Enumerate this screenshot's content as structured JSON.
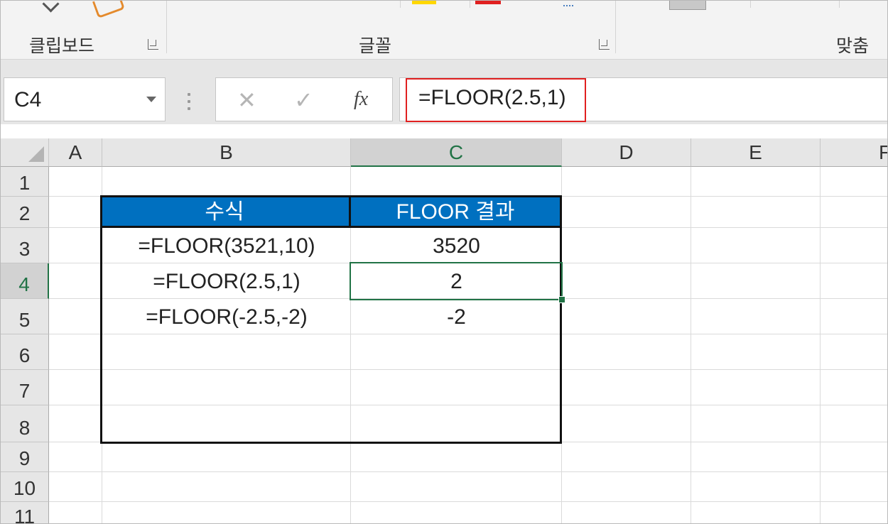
{
  "ribbon": {
    "groups": [
      {
        "label": "클립보드"
      },
      {
        "label": "글꼴"
      },
      {
        "label": "맞춤"
      }
    ]
  },
  "formula_bar": {
    "name_box": "C4",
    "cancel_icon": "✕",
    "enter_icon": "✓",
    "fx_label": "fx",
    "formula": "=FLOOR(2.5,1)"
  },
  "grid": {
    "columns": [
      "A",
      "B",
      "C",
      "D",
      "E",
      "F"
    ],
    "rows": [
      "1",
      "2",
      "3",
      "4",
      "5",
      "6",
      "7",
      "8",
      "9",
      "10",
      "11"
    ],
    "selected_cell": "C4"
  },
  "table": {
    "headers": [
      "수식",
      "FLOOR 결과"
    ],
    "rows": [
      {
        "formula": "=FLOOR(3521,10)",
        "result": "3520"
      },
      {
        "formula": "=FLOOR(2.5,1)",
        "result": "2"
      },
      {
        "formula": "=FLOOR(-2.5,-2)",
        "result": "-2"
      }
    ]
  },
  "colors": {
    "header_fill": "#0070c0",
    "selection": "#217346",
    "highlight": "#e02020"
  }
}
